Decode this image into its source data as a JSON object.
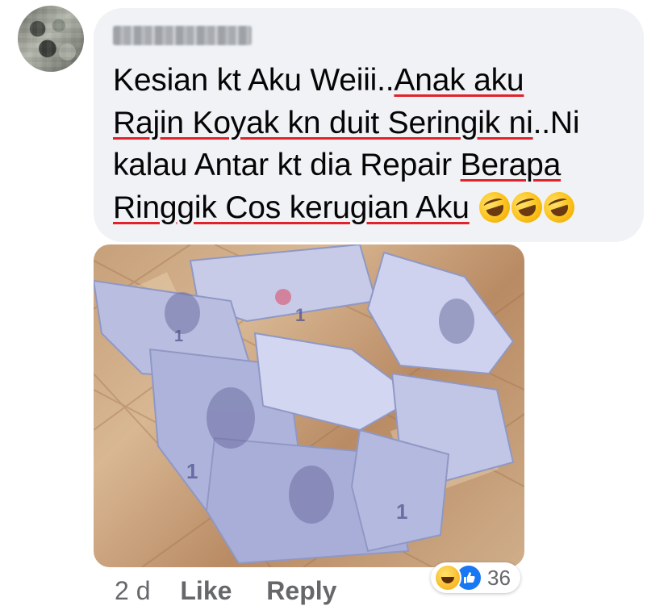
{
  "comment": {
    "author_name": "Sari Lipani",
    "lines": [
      {
        "plain": "Kesian kt Aku Weiii..",
        "underlined": "Anak aku"
      },
      {
        "plain": "",
        "underlined": "Rajin Koyak kn duit Seringik ni",
        "after": "..Ni"
      },
      {
        "plain": "kalau Antar kt dia Repair ",
        "underlined": "Berapa"
      },
      {
        "plain": "",
        "underlined": "Ringgik Cos kerugian Aku"
      }
    ],
    "emoji_icons": [
      "rolling-on-floor-laughing-icon",
      "rolling-on-floor-laughing-icon",
      "rolling-on-floor-laughing-icon"
    ]
  },
  "meta": {
    "time": "2 d",
    "like_label": "Like",
    "reply_label": "Reply"
  },
  "reactions": {
    "icons": [
      "haha-reaction-icon",
      "like-reaction-icon"
    ],
    "count": "36"
  },
  "colors": {
    "bubble": "#f0f2f5",
    "underline": "#e0232b",
    "meta_text": "#65676b",
    "like_blue": "#1877f2"
  }
}
